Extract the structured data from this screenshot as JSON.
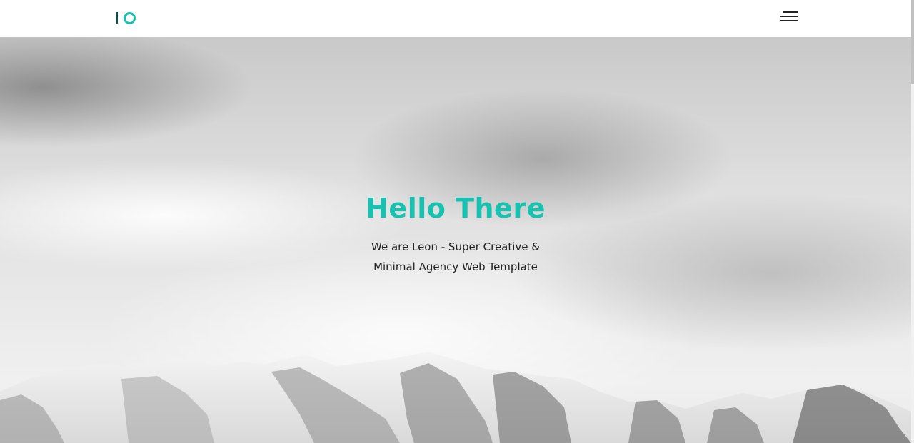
{
  "header": {
    "logo_alt": "IO logo",
    "menu_icon": "hamburger-menu-icon"
  },
  "hero": {
    "title": "Hello There",
    "subtitle_line1": "We are Leon - Super Creative &",
    "subtitle_line2": "Minimal Agency Web Template",
    "background": "cloudy-sky-mountains-image"
  },
  "colors": {
    "accent": "#17c2b0",
    "logo_dark": "#0f4f4c",
    "text": "#222222",
    "header_bg": "#ffffff"
  }
}
